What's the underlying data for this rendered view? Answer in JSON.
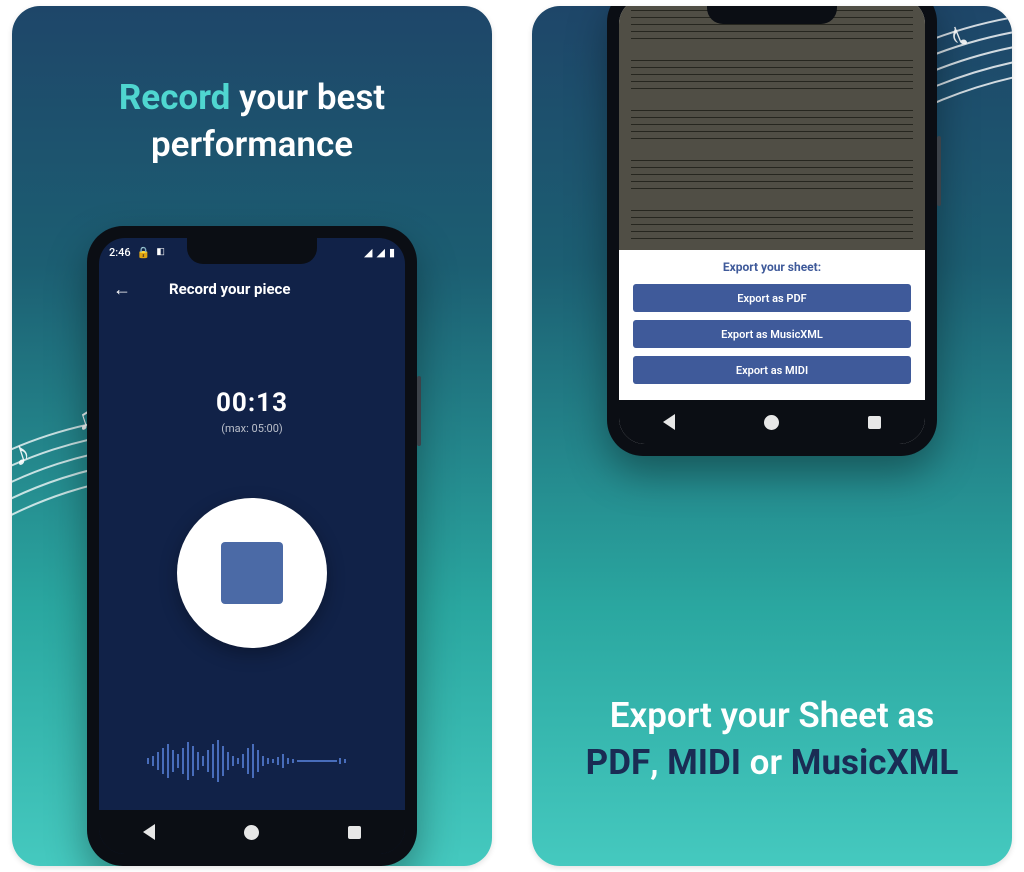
{
  "panel1": {
    "headline_accent": "Record",
    "headline_rest_line1": " your best",
    "headline_line2": "performance",
    "statusbar": {
      "time": "2:46",
      "right_icons": "▾◢▮"
    },
    "appbar": {
      "title": "Record your piece"
    },
    "timer": {
      "value": "00:13",
      "max": "(max: 05:00)"
    }
  },
  "panel2": {
    "export": {
      "title": "Export your sheet:",
      "buttons": {
        "pdf": "Export as PDF",
        "musicxml": "Export as MusicXML",
        "midi": "Export as MIDI"
      }
    },
    "headline_line1": "Export your Sheet as",
    "headline_accent1": "PDF",
    "headline_sep1": ", ",
    "headline_accent2": "MIDI",
    "headline_sep2": " or ",
    "headline_accent3": "MusicXML"
  }
}
